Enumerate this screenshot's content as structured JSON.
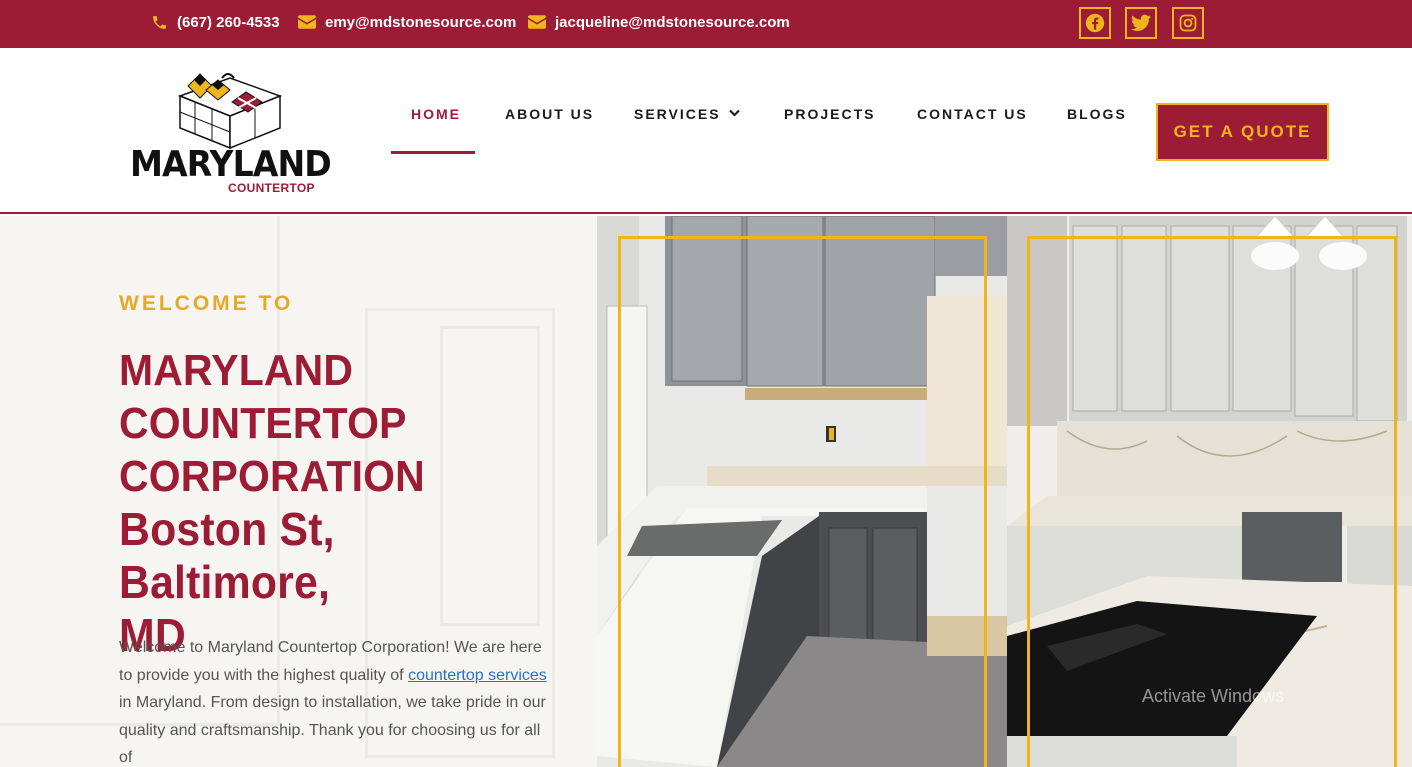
{
  "topbar": {
    "phone": "(667) 260-4533",
    "email1": "emy@mdstonesource.com",
    "email2": "jacqueline@mdstonesource.com",
    "social": [
      "facebook-icon",
      "twitter-icon",
      "instagram-icon"
    ]
  },
  "brand": {
    "name": "MARYLAND",
    "sub": "COUNTERTOP"
  },
  "nav": {
    "items": [
      {
        "label": "HOME",
        "active": true
      },
      {
        "label": "ABOUT US"
      },
      {
        "label": "SERVICES",
        "has_dropdown": true
      },
      {
        "label": "PROJECTS"
      },
      {
        "label": "CONTACT US"
      },
      {
        "label": "BLOGS"
      }
    ],
    "cta": "GET A QUOTE"
  },
  "hero": {
    "kicker": "WELCOME TO",
    "title_lines": [
      "MARYLAND",
      "COUNTERTOP",
      "CORPORATION"
    ],
    "location_lines": [
      "Boston St, Baltimore,",
      "MD"
    ],
    "text_before_link": "Welcome to Maryland Countertop Corporation! We are here to provide you with the highest quality of ",
    "link_text": "countertop services",
    "text_after_link": " in Maryland. From design to installation, we take pride in our quality and craftsmanship. Thank you for choosing us for all of"
  },
  "overlay": {
    "watermark": "Activate Windows"
  },
  "colors": {
    "brand_red": "#9b1c34",
    "gold": "#f0b51c",
    "kicker": "#e6a82a",
    "link": "#2a6fc7"
  }
}
